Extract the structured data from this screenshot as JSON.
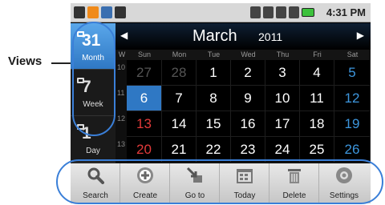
{
  "callout": {
    "label": "Views"
  },
  "statusbar": {
    "time": "4:31 PM"
  },
  "views": [
    {
      "num": "31",
      "label": "Month",
      "active": true
    },
    {
      "num": "7",
      "label": "Week",
      "active": false
    },
    {
      "num": "1",
      "label": "Day",
      "active": false
    }
  ],
  "calendar": {
    "month": "March",
    "year": "2011",
    "prev_glyph": "◀",
    "next_glyph": "▶",
    "weekdays": [
      "W",
      "Sun",
      "Mon",
      "Tue",
      "Wed",
      "Thu",
      "Fri",
      "Sat"
    ],
    "weeks": [
      {
        "num": "10",
        "days": [
          "27",
          "28",
          "1",
          "2",
          "3",
          "4",
          "5"
        ]
      },
      {
        "num": "11",
        "days": [
          "6",
          "7",
          "8",
          "9",
          "10",
          "11",
          "12"
        ]
      },
      {
        "num": "12",
        "days": [
          "13",
          "14",
          "15",
          "16",
          "17",
          "18",
          "19"
        ]
      },
      {
        "num": "13",
        "days": [
          "20",
          "21",
          "22",
          "23",
          "24",
          "25",
          "26"
        ]
      }
    ],
    "selected_day": "6"
  },
  "toolbar": [
    {
      "label": "Search",
      "icon": "search-icon"
    },
    {
      "label": "Create",
      "icon": "create-icon"
    },
    {
      "label": "Go to",
      "icon": "goto-icon"
    },
    {
      "label": "Today",
      "icon": "today-icon"
    },
    {
      "label": "Delete",
      "icon": "delete-icon"
    },
    {
      "label": "Settings",
      "icon": "settings-icon"
    }
  ],
  "colors": {
    "accent": "#2f78c4",
    "sunday": "#e23a3a",
    "saturday": "#3d96dd",
    "highlight": "#3a7fd8"
  }
}
